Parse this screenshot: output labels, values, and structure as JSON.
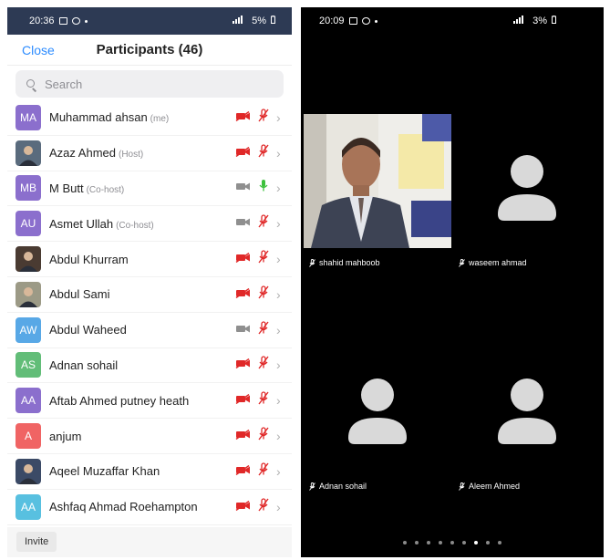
{
  "left": {
    "status": {
      "time": "20:36",
      "battery": "5%"
    },
    "close_label": "Close",
    "title": "Participants (46)",
    "search_placeholder": "Search",
    "invite_label": "Invite",
    "participants": [
      {
        "name": "Muhammad ahsan",
        "role": "(me)",
        "initials": "MA",
        "avatar_color": "#8b6fcd",
        "video": "off",
        "audio": "muted"
      },
      {
        "name": "Azaz Ahmed",
        "role": "(Host)",
        "initials": "",
        "avatar_color": "#5a6b7d",
        "video": "off",
        "audio": "muted"
      },
      {
        "name": "M Butt",
        "role": "(Co-host)",
        "initials": "MB",
        "avatar_color": "#8b6fcd",
        "video": "on",
        "audio": "active"
      },
      {
        "name": "Asmet Ullah",
        "role": "(Co-host)",
        "initials": "AU",
        "avatar_color": "#8b6fcd",
        "video": "on",
        "audio": "muted"
      },
      {
        "name": "Abdul Khurram",
        "role": "",
        "initials": "",
        "avatar_color": "#4a3b32",
        "video": "off",
        "audio": "muted"
      },
      {
        "name": "Abdul Sami",
        "role": "",
        "initials": "",
        "avatar_color": "#9c9a86",
        "video": "off",
        "audio": "muted"
      },
      {
        "name": "Abdul Waheed",
        "role": "",
        "initials": "AW",
        "avatar_color": "#58a8e6",
        "video": "on",
        "audio": "muted"
      },
      {
        "name": "Adnan sohail",
        "role": "",
        "initials": "AS",
        "avatar_color": "#62bd78",
        "video": "off",
        "audio": "muted"
      },
      {
        "name": "Aftab Ahmed putney heath",
        "role": "",
        "initials": "AA",
        "avatar_color": "#8b6fcd",
        "video": "off",
        "audio": "muted"
      },
      {
        "name": "anjum",
        "role": "",
        "initials": "A",
        "avatar_color": "#f06464",
        "video": "off",
        "audio": "muted"
      },
      {
        "name": "Aqeel Muzaffar Khan",
        "role": "",
        "initials": "",
        "avatar_color": "#3b4a66",
        "video": "off",
        "audio": "muted"
      },
      {
        "name": "Ashfaq Ahmad Roehampton",
        "role": "",
        "initials": "AA",
        "avatar_color": "#58c0e0",
        "video": "off",
        "audio": "muted"
      }
    ]
  },
  "right": {
    "status": {
      "time": "20:09",
      "battery": "3%"
    },
    "tiles": [
      {
        "name": "shahid mahboob",
        "has_video": true
      },
      {
        "name": "waseem ahmad",
        "has_video": false
      },
      {
        "name": "Adnan sohail",
        "has_video": false
      },
      {
        "name": "Aleem Ahmed",
        "has_video": false
      }
    ],
    "page_count": 9,
    "active_page": 7
  },
  "colors": {
    "accent": "#2d8cff",
    "muted_red": "#e02828",
    "mic_green": "#3cc13c",
    "status_bar": "#2d3a54"
  }
}
